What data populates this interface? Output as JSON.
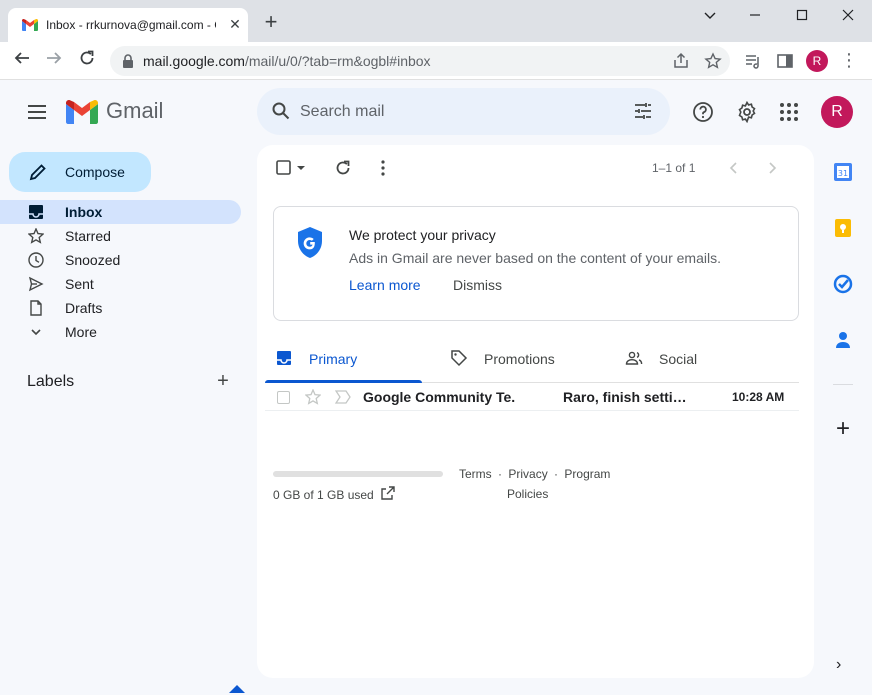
{
  "browser": {
    "tab_title": "Inbox - rrkurnova@gmail.com - G",
    "tab_close": "✕",
    "new_tab": "+",
    "url_host": "mail.google.com",
    "url_path": "/mail/u/0/?tab=rm&ogbl#inbox",
    "profile_initial": "R",
    "menu": "⋮"
  },
  "header": {
    "product": "Gmail",
    "search_placeholder": "Search mail",
    "avatar_initial": "R"
  },
  "sidebar": {
    "compose_label": "Compose",
    "items": [
      {
        "label": "Inbox",
        "icon": "inbox-icon",
        "active": true
      },
      {
        "label": "Starred",
        "icon": "star-icon"
      },
      {
        "label": "Snoozed",
        "icon": "clock-icon"
      },
      {
        "label": "Sent",
        "icon": "send-icon"
      },
      {
        "label": "Drafts",
        "icon": "draft-icon"
      },
      {
        "label": "More",
        "icon": "chevron-down-icon"
      }
    ],
    "labels_title": "Labels",
    "labels_add": "+"
  },
  "main": {
    "pager": "1–1 of 1",
    "privacy": {
      "title": "We protect your privacy",
      "body": "Ads in Gmail are never based on the content of your emails.",
      "learn_more": "Learn more",
      "dismiss": "Dismiss"
    },
    "tabs": [
      {
        "label": "Primary",
        "icon": "inbox-tab-icon",
        "active": true
      },
      {
        "label": "Promotions",
        "icon": "tag-icon"
      },
      {
        "label": "Social",
        "icon": "people-icon"
      }
    ],
    "rows": [
      {
        "sender": "Google Community Te.",
        "subject": "Raro, finish setti…",
        "time": "10:28 AM"
      }
    ],
    "storage_text": "0 GB of 1 GB used",
    "footer": {
      "terms": "Terms",
      "privacy": "Privacy",
      "program": "Program",
      "policies": "Policies",
      "sep": "·"
    }
  },
  "rail": {
    "add": "+",
    "expand": "›"
  },
  "colors": {
    "accent": "#0b57d0",
    "compose_bg": "#c2e7ff",
    "active_nav": "#d3e3fd",
    "avatar": "#c2185b"
  }
}
